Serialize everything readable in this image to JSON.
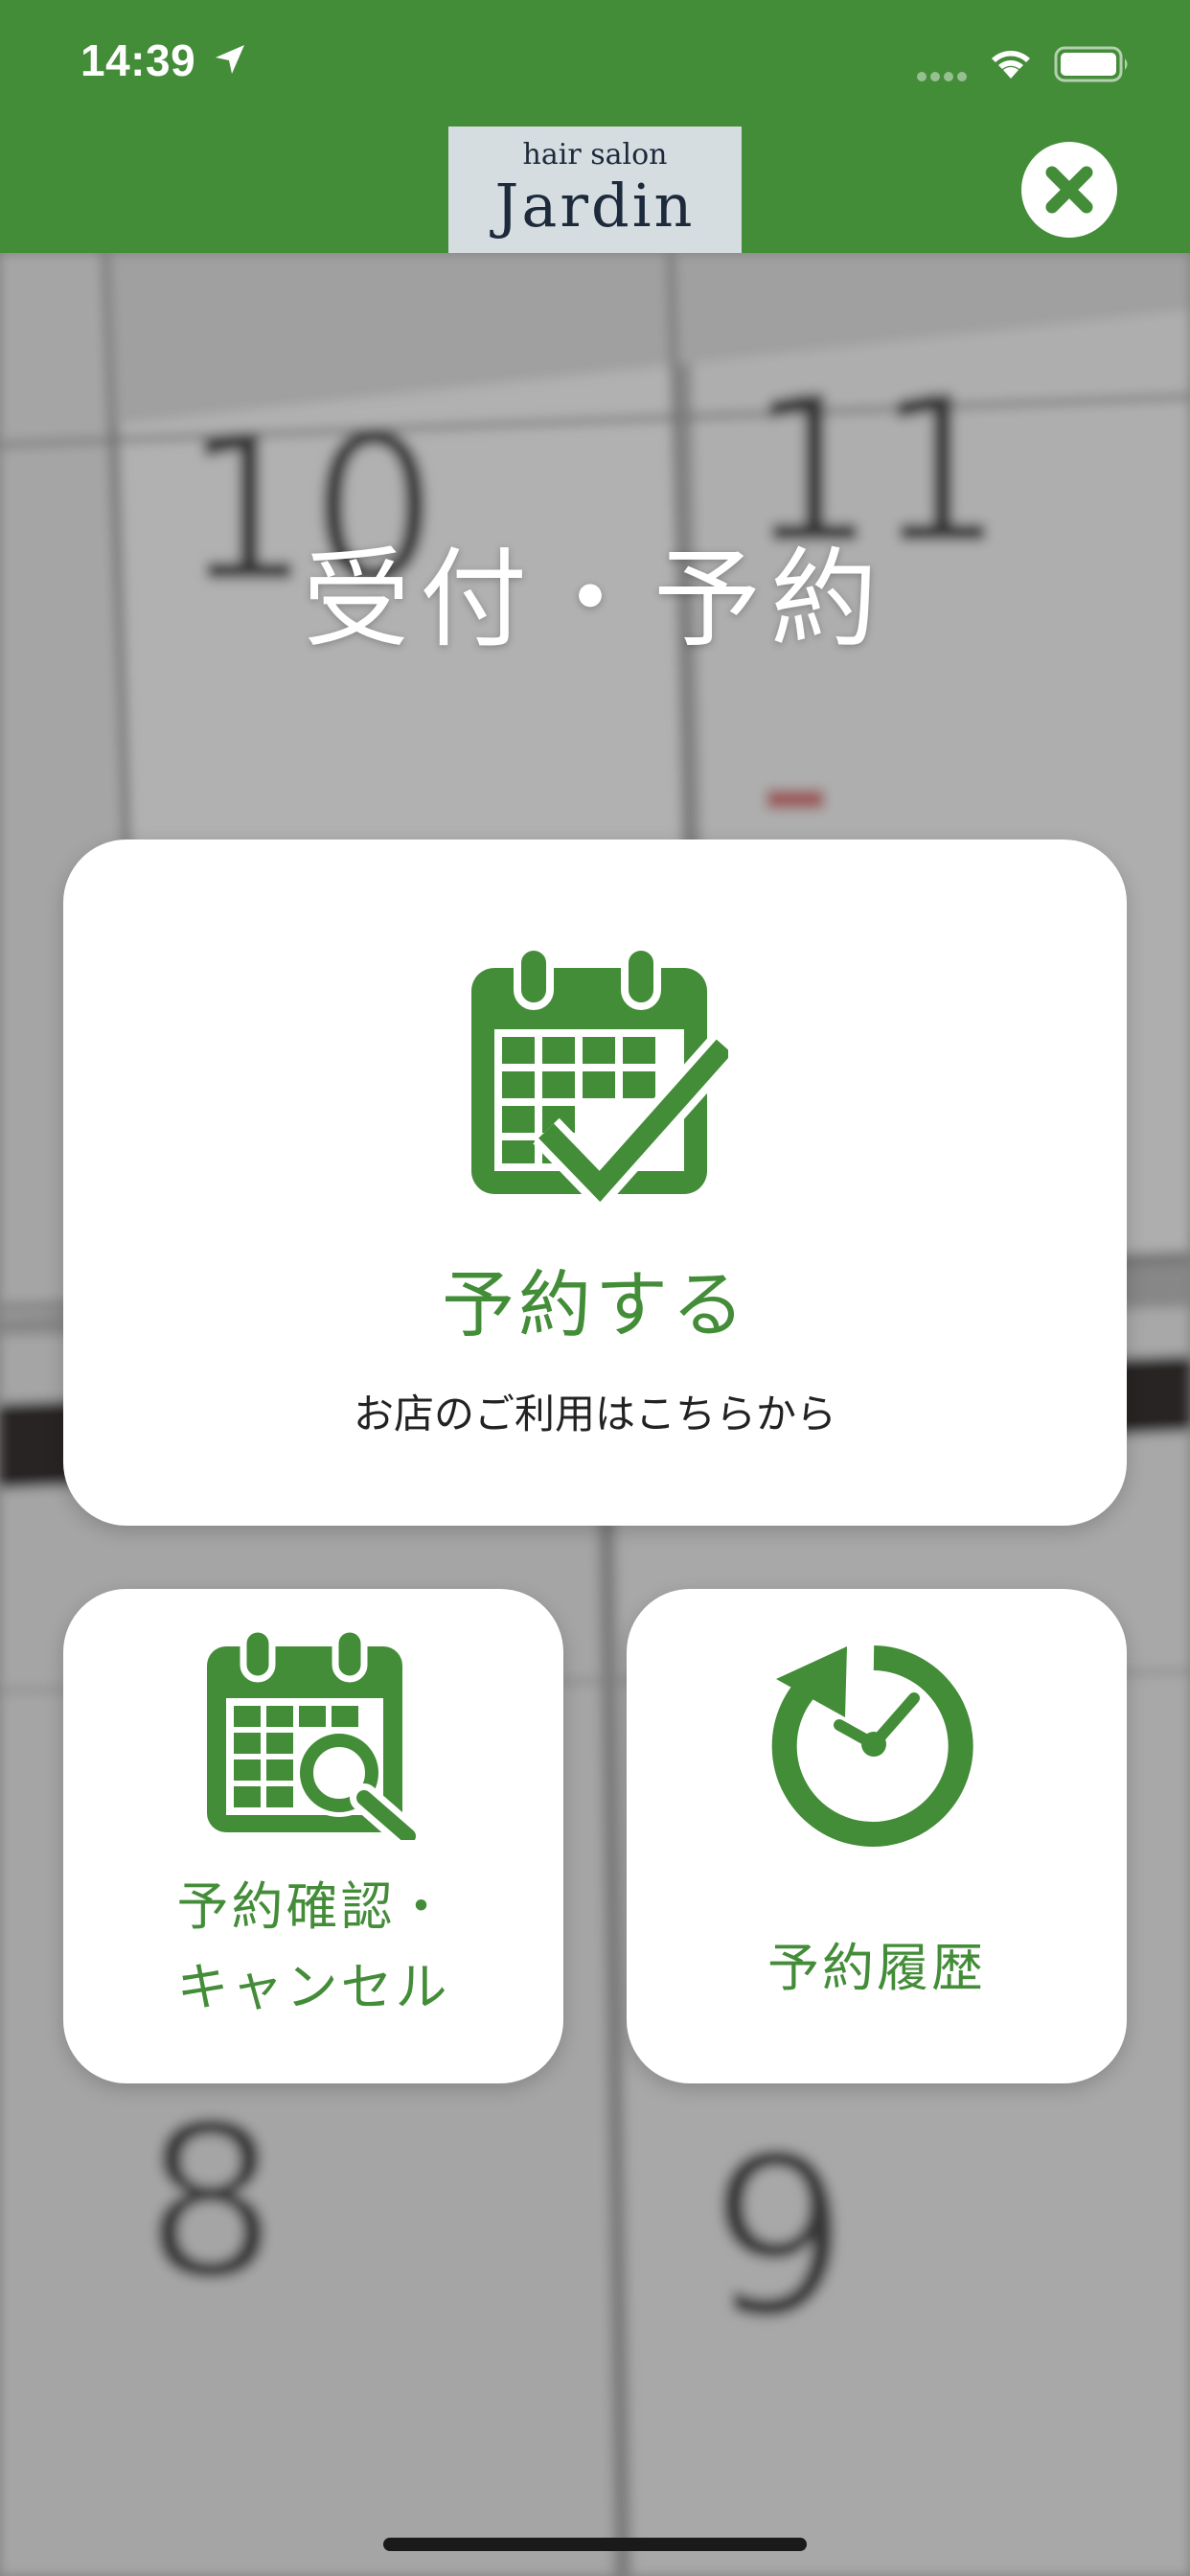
{
  "status_bar": {
    "time": "14:39"
  },
  "header": {
    "logo_small": "hair salon",
    "logo_big": "Jardin"
  },
  "title": "受付・予約",
  "cards": {
    "reserve": {
      "label": "予約する",
      "sub": "お店のご利用はこちらから"
    },
    "confirm": {
      "label_line1": "予約確認・",
      "label_line2": "キャンセル"
    },
    "history": {
      "label": "予約履歴"
    }
  },
  "icons": {
    "close": "close-icon",
    "reserve": "calendar-check-icon",
    "confirm": "calendar-search-icon",
    "history": "history-clock-icon"
  },
  "colors": {
    "brand_green": "#438c38",
    "header_green": "#438c38",
    "logo_bg": "#d6dde1"
  }
}
